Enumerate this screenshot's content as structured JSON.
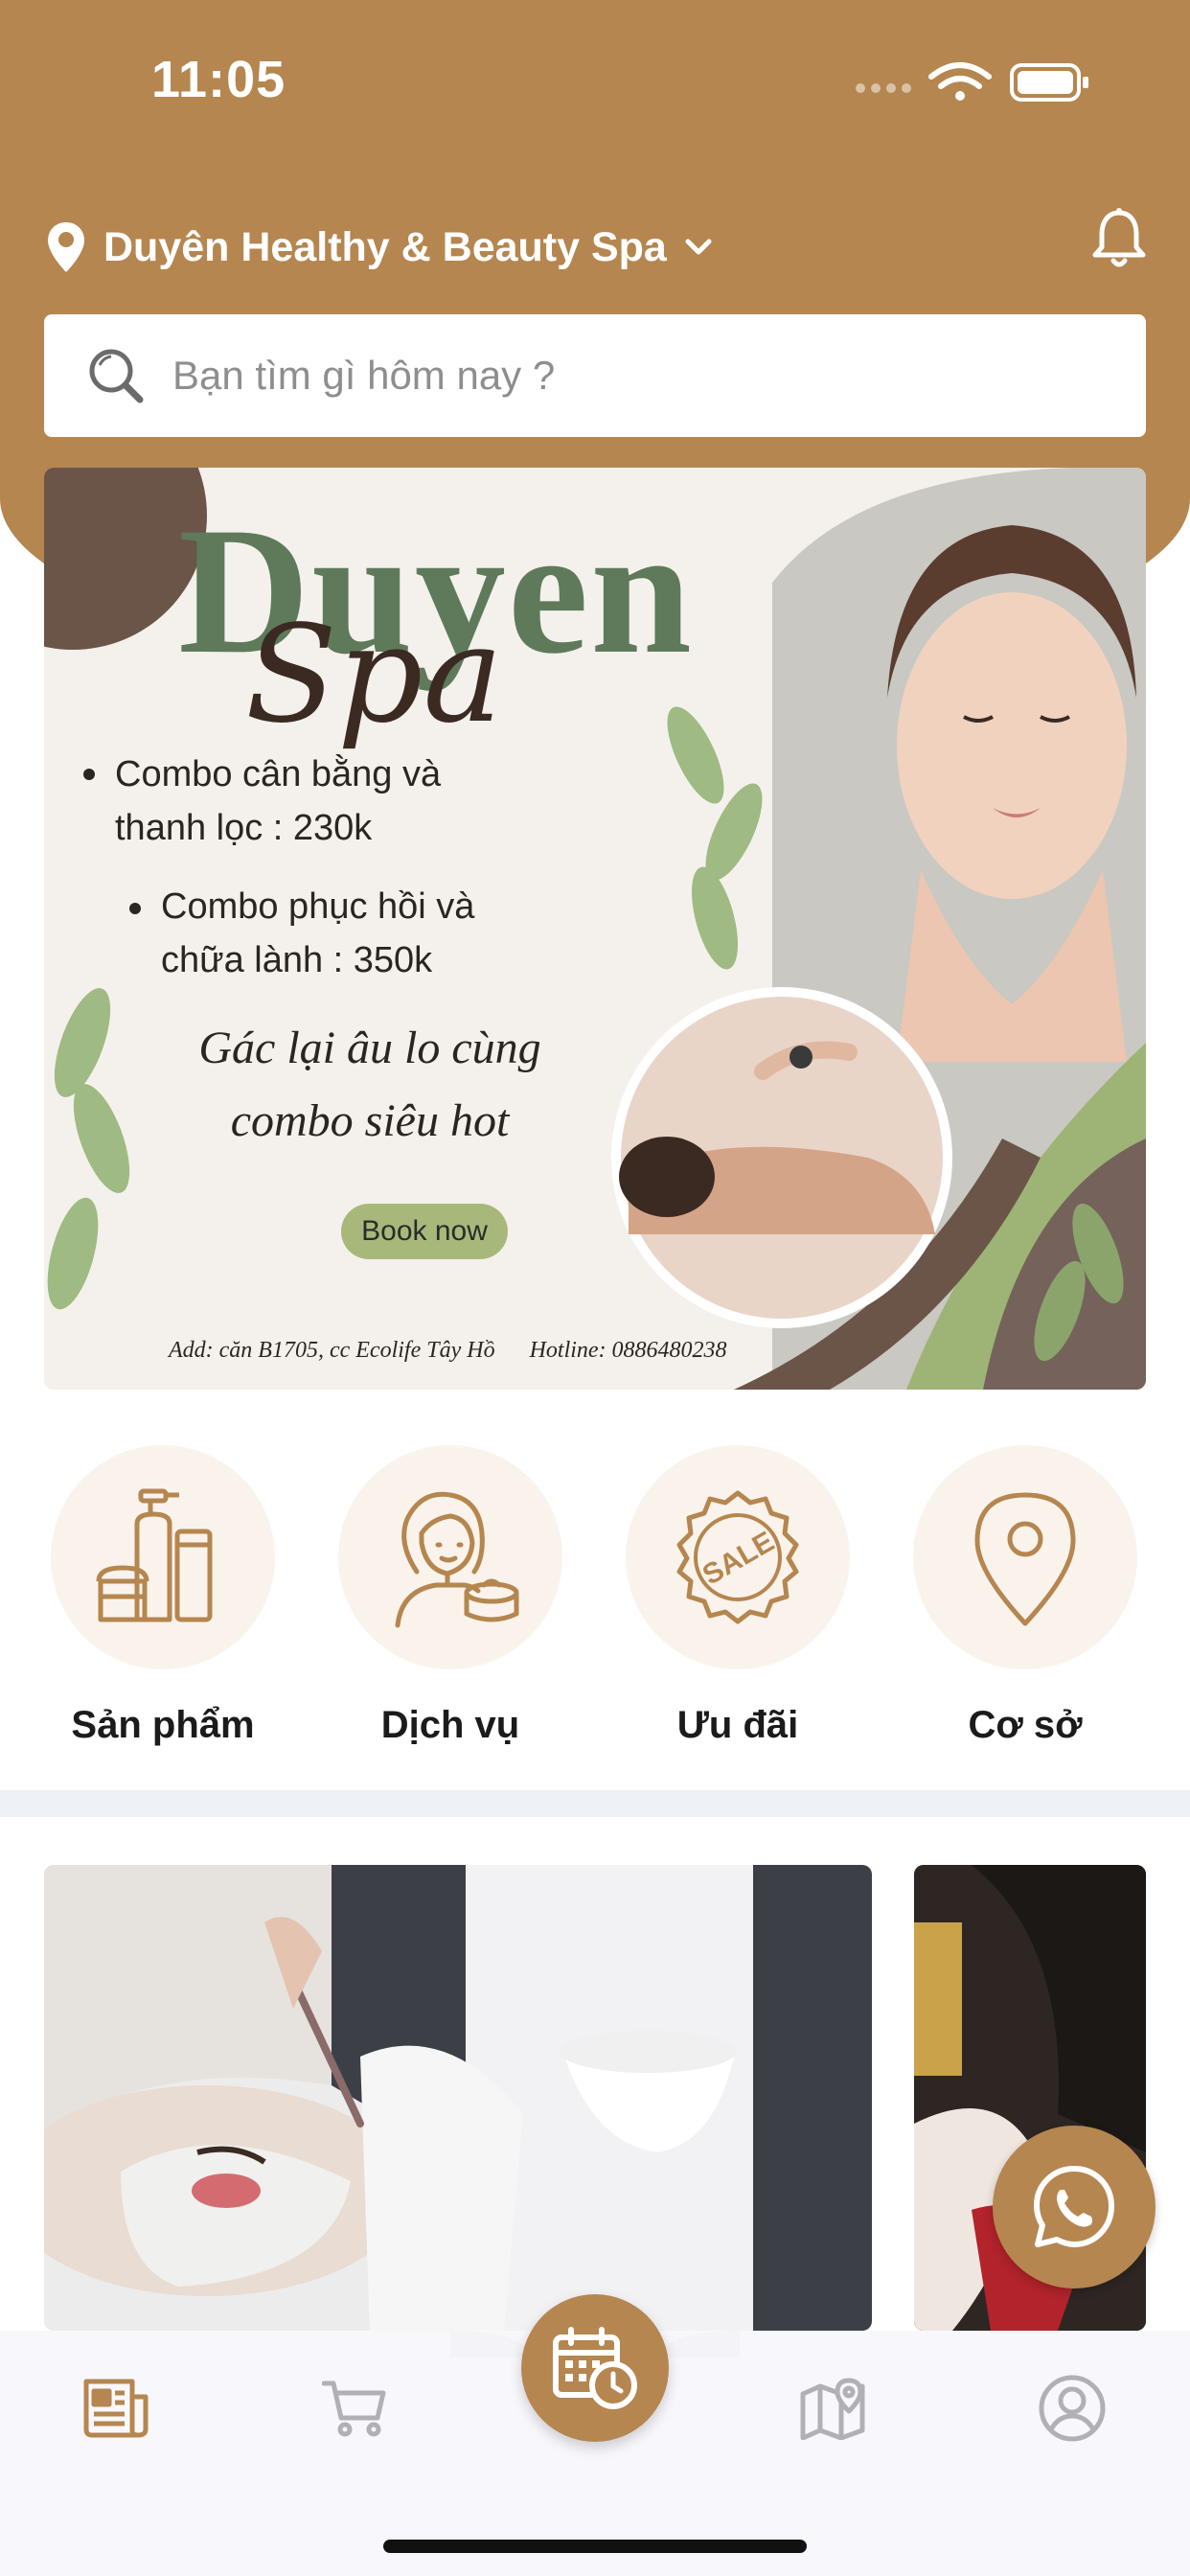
{
  "status_bar": {
    "time": "11:05"
  },
  "header": {
    "location_name": "Duyên Healthy & Beauty Spa",
    "search_placeholder": "Bạn tìm gì hôm nay ?"
  },
  "banner": {
    "title": "Duyen",
    "subtitle": "Spa",
    "bullets": [
      "Combo cân bằng và thanh lọc : 230k",
      "Combo phục hồi và chữa lành : 350k"
    ],
    "slogan_line1": "Gác lại âu lo cùng",
    "slogan_line2": "combo siêu hot",
    "cta": "Book now",
    "address": "Add: căn B1705, cc Ecolife Tây Hồ",
    "hotline": "Hotline: 0886480238"
  },
  "categories": [
    {
      "label": "Sản phẩm",
      "icon": "cosmetics-products-icon"
    },
    {
      "label": "Dịch vụ",
      "icon": "woman-service-icon"
    },
    {
      "label": "Ưu đãi",
      "icon": "sale-badge-icon"
    },
    {
      "label": "Cơ sở",
      "icon": "location-pin-icon"
    }
  ],
  "bottom_nav": [
    {
      "name": "news",
      "icon": "newspaper-icon",
      "active": true
    },
    {
      "name": "cart",
      "icon": "cart-icon",
      "active": false
    },
    {
      "name": "booking",
      "icon": "calendar-clock-icon",
      "active": false
    },
    {
      "name": "map",
      "icon": "map-pin-icon",
      "active": false
    },
    {
      "name": "account",
      "icon": "user-circle-icon",
      "active": false
    }
  ],
  "colors": {
    "brand": "#b5864f",
    "banner_green": "#5e7a5a",
    "cta_green": "#a8b87b"
  }
}
